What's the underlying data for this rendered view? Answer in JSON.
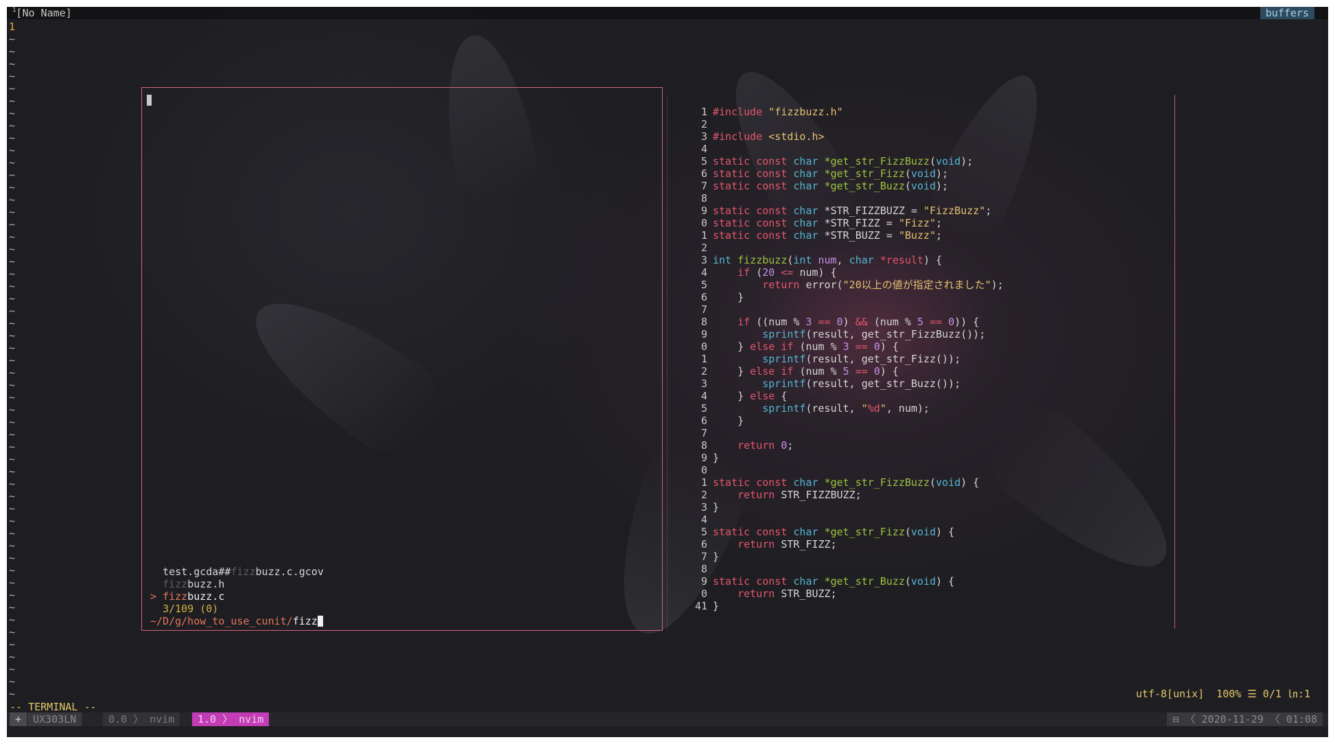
{
  "tab": {
    "number": "1",
    "title": "[No Name]",
    "buffers_label": "buffers"
  },
  "editor": {
    "first_line_number": "1",
    "tilde": "~"
  },
  "finder": {
    "results": [
      {
        "prefix": "test.gcda##",
        "match": "fizz",
        "suffix": "buzz.c.gcov"
      },
      {
        "prefix": "",
        "match": "fizz",
        "suffix": "buzz.h"
      },
      {
        "prefix": "",
        "match": "fizz",
        "suffix": "buzz.c",
        "selected": true
      }
    ],
    "selected_marker": ">",
    "count": "3/109 (0)",
    "prompt_path": "~/D/g/how_to_use_cunit/",
    "prompt_query": "fizz"
  },
  "preview": {
    "line_numbers": [
      "1",
      "2",
      "3",
      "4",
      "5",
      "6",
      "7",
      "8",
      "9",
      "0",
      "1",
      "2",
      "3",
      "4",
      "5",
      "6",
      "7",
      "8",
      "9",
      "0",
      "1",
      "2",
      "3",
      "4",
      "5",
      "6",
      "7",
      "8",
      "9",
      "0",
      "1",
      "2",
      "3",
      "4",
      "5",
      "6",
      "7",
      "8",
      "9",
      "0",
      "1"
    ],
    "first_line_number_prefix": "",
    "last_line_number_prefix": "4"
  },
  "status": {
    "encoding": "utf-8[unix]",
    "percent": "100%",
    "position": "☰ 0/1",
    "column": "㏑:1",
    "mode": "-- TERMINAL --"
  },
  "tmux": {
    "plus": "+",
    "host": "UX303LN",
    "win0": "0.0 〉 nvim",
    "win1": "1.0 〉 nvim",
    "right": "⊟ 〈 2020-11-29 〈 01:08"
  },
  "colors": {
    "border": "#d6637a",
    "keyword": "#e5566e",
    "type": "#54b7d4",
    "function": "#9cc43f",
    "string": "#e6c071",
    "accent": "#e5765c",
    "tmux_active": "#c23cb5"
  }
}
